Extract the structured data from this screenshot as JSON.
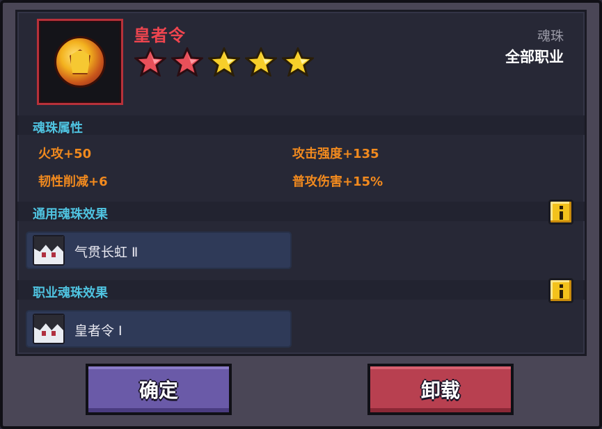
{
  "item": {
    "name": "皇者令",
    "stars": [
      {
        "color": "red"
      },
      {
        "color": "red"
      },
      {
        "color": "gold"
      },
      {
        "color": "gold"
      },
      {
        "color": "gold"
      }
    ],
    "type": "魂珠",
    "class_restriction": "全部职业",
    "icon": "soul-orb-icon"
  },
  "attributes": {
    "title": "魂珠属性",
    "items": [
      {
        "label": "火攻+50"
      },
      {
        "label": "攻击强度+135"
      },
      {
        "label": "韧性削减+6"
      },
      {
        "label": "普攻伤害+15%"
      }
    ]
  },
  "general_effect": {
    "title": "通用魂珠效果",
    "card": {
      "name": "气贯长虹 Ⅱ",
      "icon": "character-avatar-icon"
    }
  },
  "class_effect": {
    "title": "职业魂珠效果",
    "card": {
      "name": "皇者令 Ⅰ",
      "icon": "character-avatar-icon"
    }
  },
  "buttons": {
    "confirm": "确定",
    "unload": "卸载"
  },
  "colors": {
    "name": "#f0454f",
    "section_title": "#4fc3e0",
    "attribute": "#f28a1e",
    "star_red": "#e8505a",
    "star_gold": "#f7cf2a",
    "confirm_button": "#6a5aa8",
    "unload_button": "#b84050"
  }
}
